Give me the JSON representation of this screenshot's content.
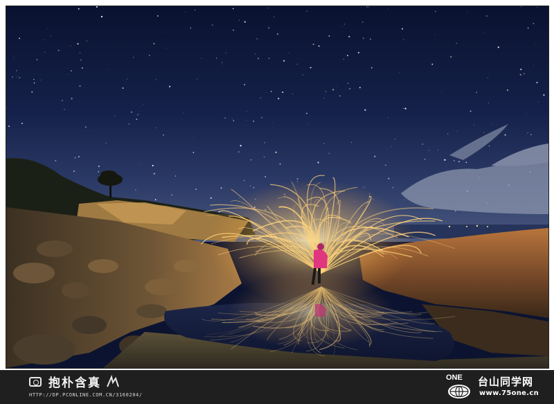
{
  "photo": {
    "subject": "person-in-pink-jacket",
    "effect": "steel-wool-light-arcs"
  },
  "watermark_left": {
    "name": "抱朴含真",
    "url": "HTTP://DP.PCONLINE.COM.CN/3160204/",
    "icon": "camera-icon"
  },
  "watermark_right": {
    "logo_text": "ONE",
    "site_name": "台山同学网",
    "site_url": "www.75one.cn",
    "icon": "globe-icon"
  },
  "colors": {
    "sky_top": "#0a1230",
    "sky_horizon": "#33416a",
    "light_gold": "#ffd27a",
    "footer": "#1f1f1f"
  }
}
